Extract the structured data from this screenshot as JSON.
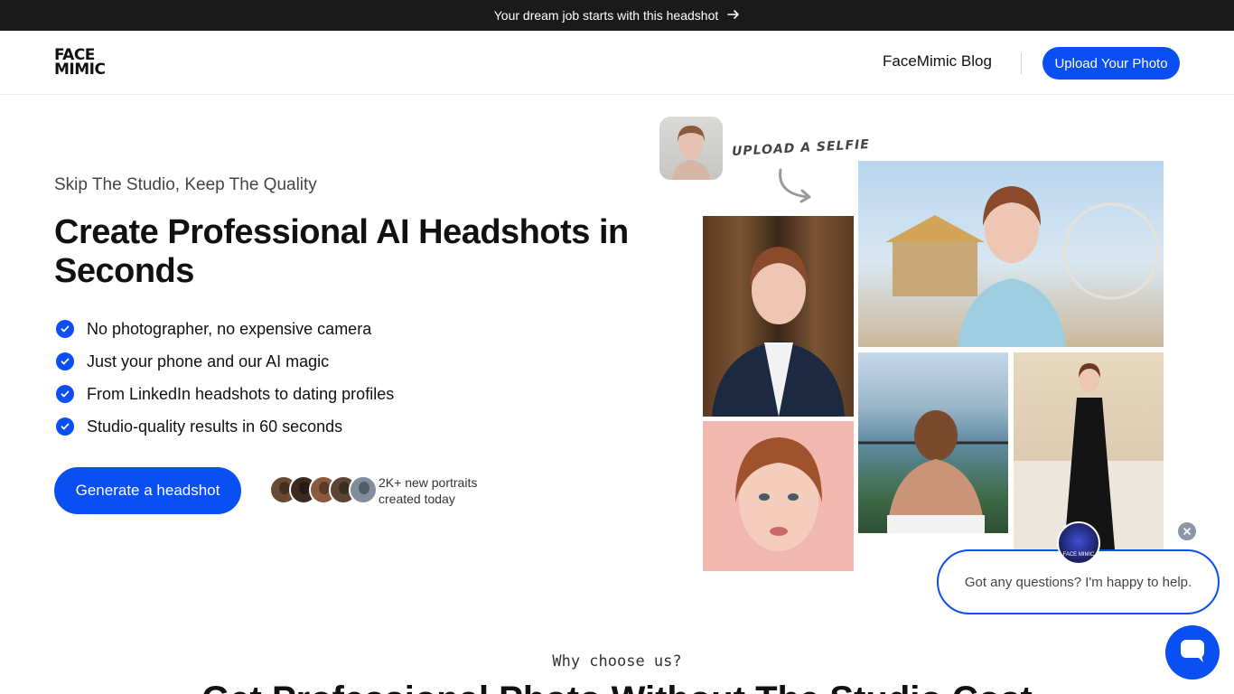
{
  "announcement": {
    "text": "Your dream job starts with this headshot",
    "icon": "arrow-right-icon"
  },
  "header": {
    "logo_line1": "FACE",
    "logo_line2": "MIMIC",
    "nav_blog": "FaceMimic Blog",
    "upload_button": "Upload Your Photo"
  },
  "hero": {
    "eyebrow": "Skip The Studio, Keep The Quality",
    "title": "Create Professional AI Headshots in Seconds",
    "features": [
      "No photographer, no expensive camera",
      "Just your phone and our AI magic",
      "From LinkedIn headshots to dating profiles",
      "Studio-quality results in 60 seconds"
    ],
    "cta": "Generate a headshot",
    "stat_line1": "2K+ new portraits",
    "stat_line2": "created today"
  },
  "collage": {
    "selfie_label": "UPLOAD A SELFIE"
  },
  "chat": {
    "message": "Got any questions? I'm happy to help.",
    "avatar_text": "FACE MIMIC"
  },
  "section": {
    "eyebrow": "Why choose us?",
    "title": "Get Professional Photo Without The Studio Cost"
  },
  "colors": {
    "accent": "#0a4ff2",
    "announcement_bg": "#1a1a1a",
    "text": "#111111"
  }
}
